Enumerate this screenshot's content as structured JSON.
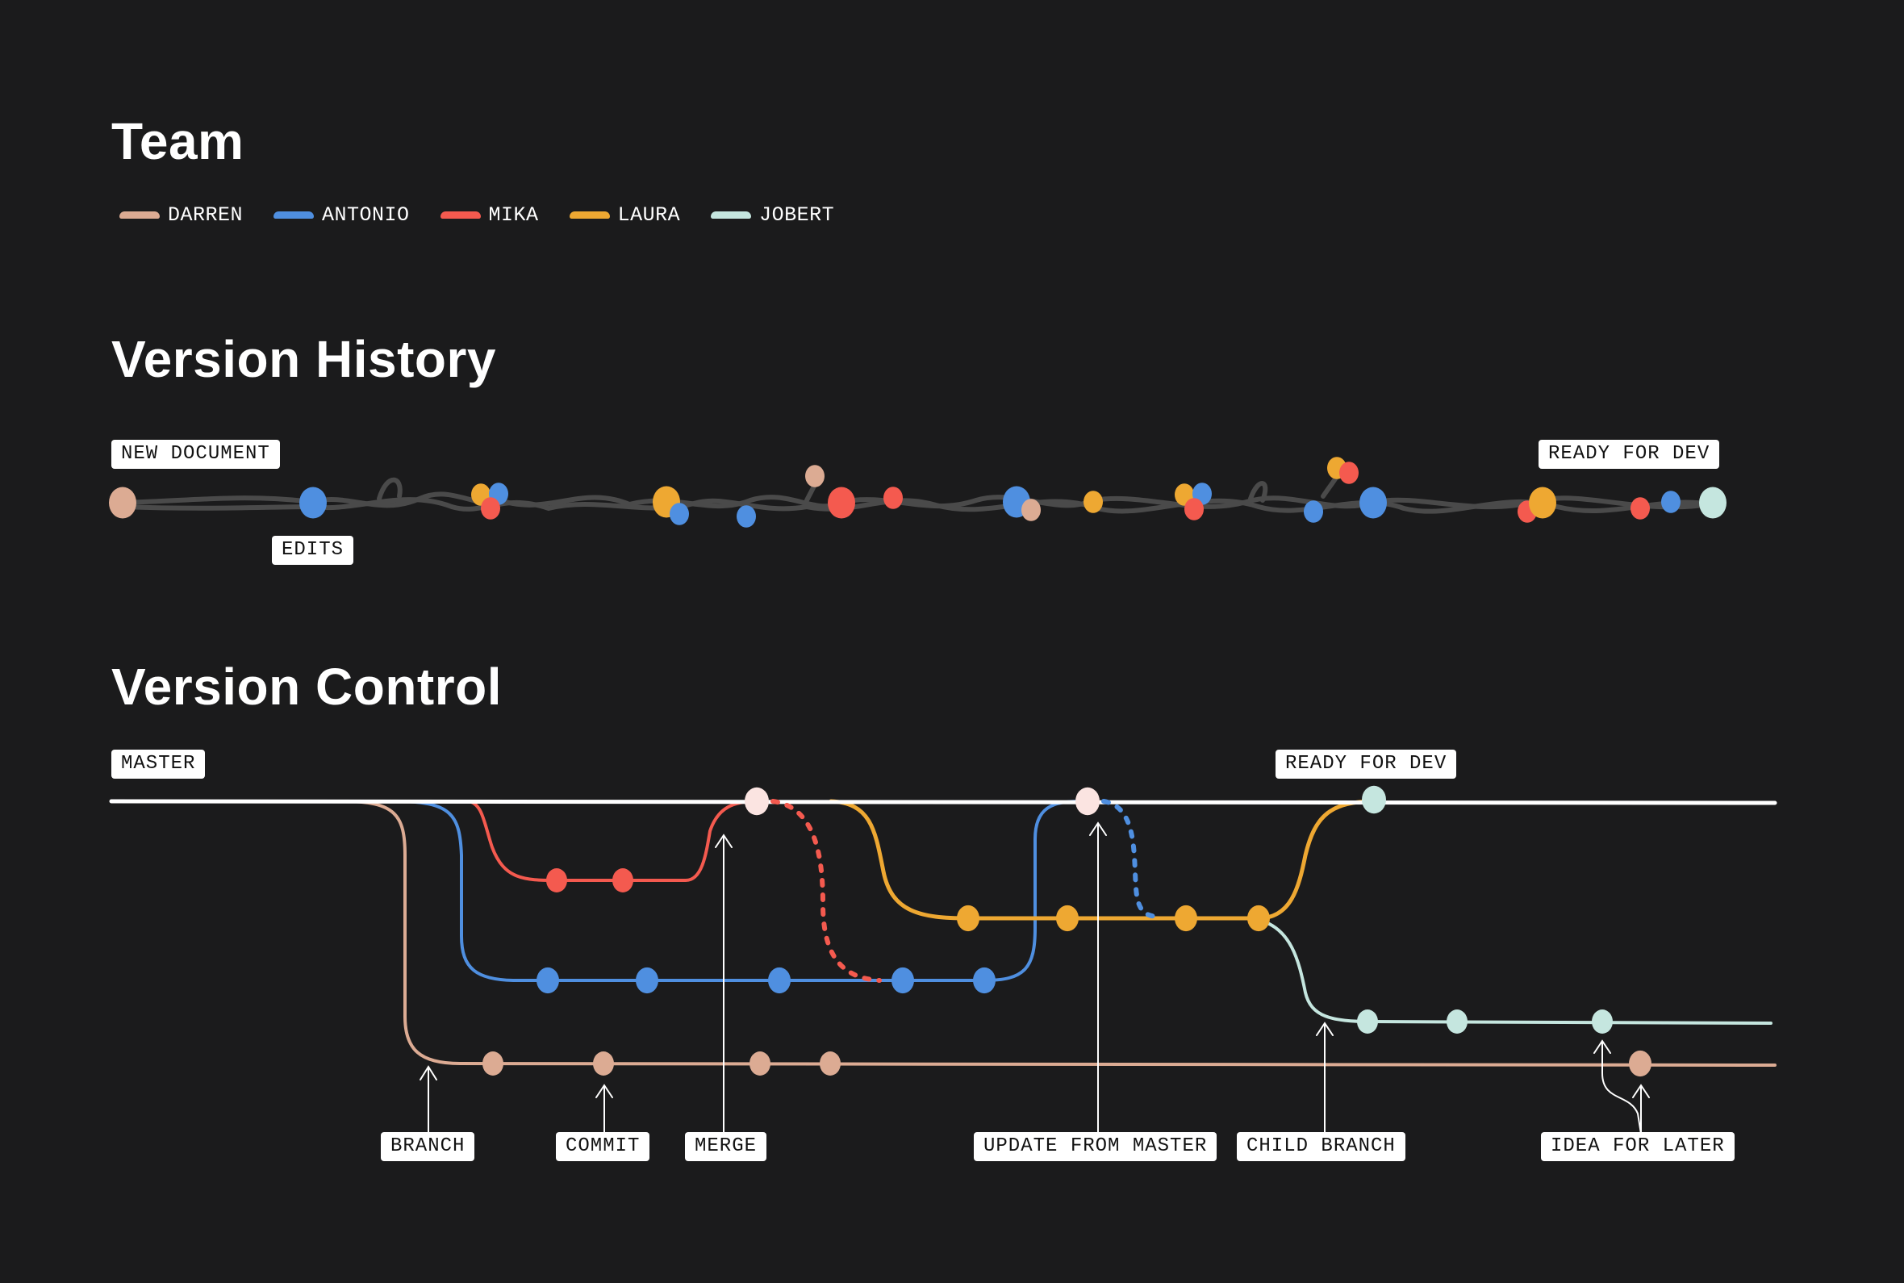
{
  "sections": {
    "team": "Team",
    "history": "Version History",
    "control": "Version Control"
  },
  "colors": {
    "background": "#1b1b1c",
    "darren": "#dcab93",
    "antonio": "#4f8fe0",
    "mika": "#f45a4f",
    "laura": "#eea832",
    "jobert": "#c5e6df",
    "master": "#ffffff",
    "merge_node": "#fbe4e1",
    "history_line": "#4a4a4a"
  },
  "team": [
    {
      "name": "DARREN",
      "color_key": "darren"
    },
    {
      "name": "ANTONIO",
      "color_key": "antonio"
    },
    {
      "name": "MIKA",
      "color_key": "mika"
    },
    {
      "name": "LAURA",
      "color_key": "laura"
    },
    {
      "name": "JOBERT",
      "color_key": "jobert"
    }
  ],
  "history": {
    "labels": {
      "start": "NEW DOCUMENT",
      "edits": "EDITS",
      "end": "READY FOR DEV"
    },
    "commits": [
      "darren",
      "antonio",
      "laura",
      "antonio",
      "mika",
      "laura",
      "antonio",
      "antonio",
      "darren",
      "mika",
      "mika",
      "antonio",
      "darren",
      "laura",
      "laura",
      "antonio",
      "mika",
      "laura",
      "mika",
      "antonio",
      "antonio",
      "mika",
      "laura",
      "mika",
      "antonio",
      "jobert"
    ]
  },
  "control": {
    "branches": [
      {
        "name": "master",
        "label": "MASTER"
      },
      {
        "name": "mika",
        "commits": 2
      },
      {
        "name": "antonio",
        "commits": 5
      },
      {
        "name": "darren",
        "commits": 5
      },
      {
        "name": "laura",
        "commits": 4
      },
      {
        "name": "jobert",
        "commits": 3
      }
    ],
    "labels": {
      "ready": "READY FOR DEV",
      "branch": "BRANCH",
      "commit": "COMMIT",
      "merge": "MERGE",
      "update": "UPDATE FROM MASTER",
      "child": "CHILD BRANCH",
      "idea": "IDEA FOR LATER"
    }
  }
}
